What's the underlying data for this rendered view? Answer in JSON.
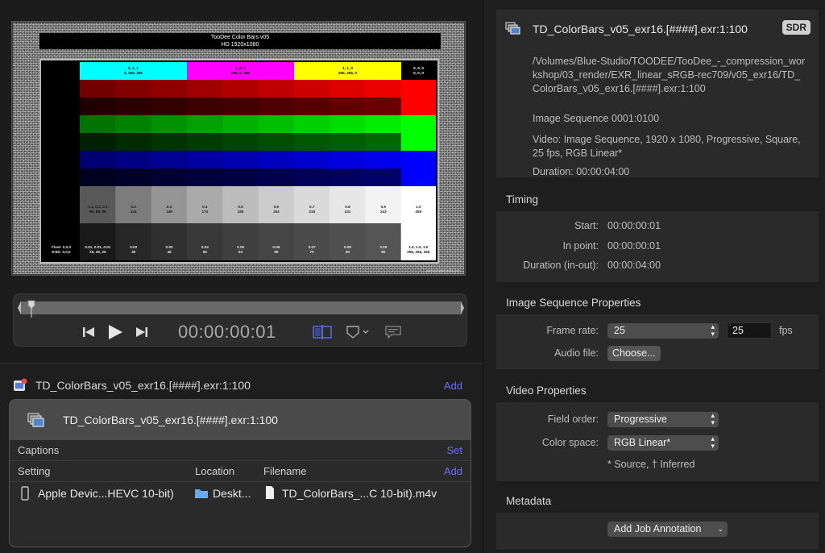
{
  "viewer": {
    "chart_title_1": "TooDee Color Bars v05",
    "chart_title_2": "HD 1920x1080",
    "top_bars": [
      {
        "label": "0, 1, 1\n0, 255, 255",
        "color": "#00ffff"
      },
      {
        "label": "1, 0, 1\n255, 0, 255",
        "color": "#ff00ff"
      },
      {
        "label": "1, 1, 0\n255, 255, 0",
        "color": "#ffff00"
      },
      {
        "label": "0, 0, 0\n0, 0, 0",
        "color": "#000000"
      }
    ],
    "gray_labels": [
      {
        "f": "0.1, 0.1, 0.1",
        "b": "89, 89, 89"
      },
      {
        "f": "0.2",
        "b": "124"
      },
      {
        "f": "0.3",
        "b": "149"
      },
      {
        "f": "0.4",
        "b": "170"
      },
      {
        "f": "0.5",
        "b": "188"
      },
      {
        "f": "0.6",
        "b": "204"
      },
      {
        "f": "0.7",
        "b": "218"
      },
      {
        "f": "0.8",
        "b": "231"
      },
      {
        "f": "0.9",
        "b": "243"
      },
      {
        "f": "1.0",
        "b": "255"
      }
    ],
    "dark_labels": [
      {
        "f": "0.01, 0.01, 0.01",
        "b": "25, 25, 25"
      },
      {
        "f": "0.02",
        "b": "39"
      },
      {
        "f": "0.03",
        "b": "48"
      },
      {
        "f": "0.04",
        "b": "56"
      },
      {
        "f": "0.05",
        "b": "63"
      },
      {
        "f": "0.06",
        "b": "69"
      },
      {
        "f": "0.07",
        "b": "75"
      },
      {
        "f": "0.08",
        "b": "80"
      },
      {
        "f": "0.09",
        "b": "85"
      },
      {
        "f": "1.0, 1.0, 1.0",
        "b": "255, 255, 255"
      }
    ],
    "float_label": "Float: 0,0,0",
    "bit_label": "8-Bit: 0,0,0",
    "credit": "www.toodeemedia.com"
  },
  "transport": {
    "timecode": "00:00:00:01",
    "playhead_fraction": 0.0
  },
  "job": {
    "title": "TD_ColorBars_v05_exr16.[####].exr:1:100",
    "add_label": "Add",
    "source_name": "TD_ColorBars_v05_exr16.[####].exr:1:100",
    "captions_label": "Captions",
    "set_label": "Set",
    "col_setting": "Setting",
    "col_location": "Location",
    "col_filename": "Filename",
    "col_add": "Add",
    "output": {
      "setting": "Apple Devic...HEVC 10-bit)",
      "location": "Deskt...",
      "filename": "TD_ColorBars_...C 10-bit).m4v"
    }
  },
  "inspector": {
    "file_name": "TD_ColorBars_v05_exr16.[####].exr:1:100",
    "badge": "SDR",
    "path": "/Volumes/Blue-Studio/TOODEE/TooDee_-_compression_workshop/03_render/EXR_linear_sRGB-rec709/v05_exr16/TD_ColorBars_v05_exr16.[####].exr:1:100",
    "sequence": "Image Sequence 0001:0100",
    "video": "Video: Image Sequence, 1920 x 1080, Progressive, Square, 25 fps, RGB Linear*",
    "duration": "Duration: 00:00:04:00",
    "timing_title": "Timing",
    "start_label": "Start:",
    "start_value": "00:00:00:01",
    "in_label": "In point:",
    "in_value": "00:00:00:01",
    "dur_label": "Duration (in-out):",
    "dur_value": "00:00:04:00",
    "isp_title": "Image Sequence Properties",
    "frame_rate_label": "Frame rate:",
    "frame_rate_popup": "25",
    "frame_rate_field": "25",
    "fps_label": "fps",
    "audio_label": "Audio file:",
    "choose_label": "Choose...",
    "vp_title": "Video Properties",
    "field_order_label": "Field order:",
    "field_order_value": "Progressive",
    "color_space_label": "Color space:",
    "color_space_value": "RGB Linear*",
    "note": "* Source, † Inferred",
    "meta_title": "Metadata",
    "annotation_label": "Add Job Annotation"
  },
  "colors": {
    "accent": "#6b6bff",
    "panel": "#2a2a2a",
    "background": "#1e1e1e"
  }
}
